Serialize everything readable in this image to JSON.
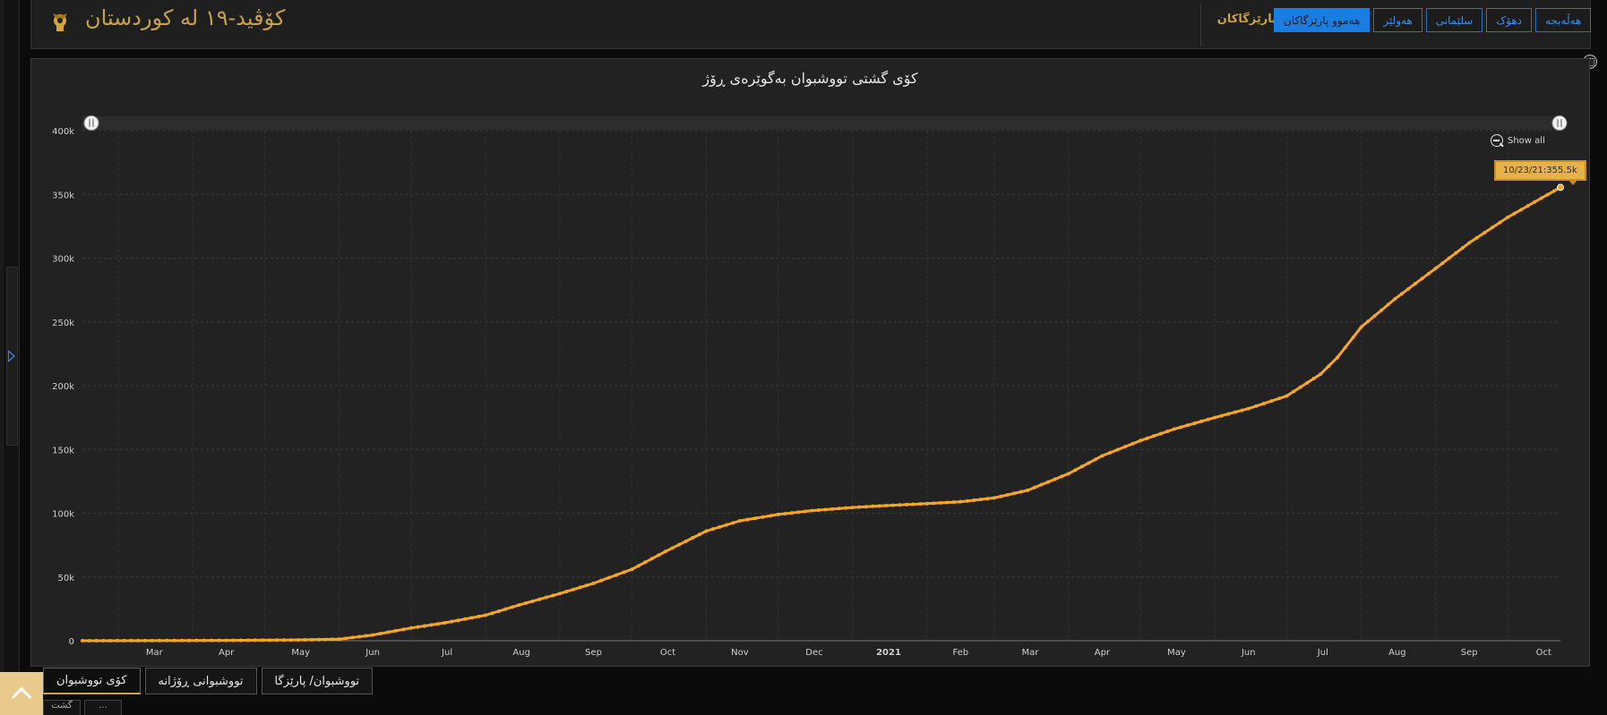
{
  "header": {
    "title": "کۆڤید-١٩ لە کوردستان",
    "provinces_label": "پارێزگاکان",
    "province_buttons": [
      {
        "label": "هەموو پارێزگاکان",
        "active": true
      },
      {
        "label": "هەولێر",
        "active": false
      },
      {
        "label": "سلێمانی",
        "active": false
      },
      {
        "label": "دهۆک",
        "active": false
      },
      {
        "label": "هەڵەبجە",
        "active": false
      }
    ]
  },
  "panel": {
    "show_all_label": "Show all",
    "tooltip_text": "10/23/21:355.5k"
  },
  "tabs": [
    {
      "label": "کۆی تووشبوان",
      "active": true
    },
    {
      "label": "تووشبوانی ڕۆژانە",
      "active": false
    },
    {
      "label": "تووشبوان/ پارێزگا",
      "active": false
    }
  ],
  "bottom_strip": [
    "گشت",
    "..."
  ],
  "colors": {
    "accent": "#f5a623",
    "title_gold": "#c9a04a",
    "button_blue": "#1a7de0",
    "panel_bg": "#222222"
  },
  "chart_data": {
    "type": "line",
    "title": "کۆی گشتی تووشبوان بەگوێرەی ڕۆژ",
    "xlabel": "",
    "ylabel": "",
    "x_tick_labels": [
      "Mar",
      "Apr",
      "May",
      "Jun",
      "Jul",
      "Aug",
      "Sep",
      "Oct",
      "Nov",
      "Dec",
      "2021",
      "Feb",
      "Mar",
      "Apr",
      "May",
      "Jun",
      "Jul",
      "Aug",
      "Sep",
      "Oct"
    ],
    "y_tick_labels": [
      "0",
      "50k",
      "100k",
      "150k",
      "200k",
      "250k",
      "300k",
      "350k",
      "400k"
    ],
    "ylim": [
      0,
      400000
    ],
    "xlim": [
      "2020-02-15",
      "2021-10-23"
    ],
    "grid": true,
    "series": [
      {
        "name": "",
        "points": [
          [
            "2020-02-15",
            0
          ],
          [
            "2020-03-15",
            100
          ],
          [
            "2020-04-15",
            300
          ],
          [
            "2020-05-15",
            600
          ],
          [
            "2020-06-01",
            1200
          ],
          [
            "2020-06-15",
            4500
          ],
          [
            "2020-07-01",
            10000
          ],
          [
            "2020-07-15",
            14000
          ],
          [
            "2020-08-01",
            20000
          ],
          [
            "2020-08-15",
            28000
          ],
          [
            "2020-09-01",
            37000
          ],
          [
            "2020-09-15",
            45000
          ],
          [
            "2020-10-01",
            56000
          ],
          [
            "2020-10-15",
            70000
          ],
          [
            "2020-11-01",
            86000
          ],
          [
            "2020-11-15",
            94000
          ],
          [
            "2020-12-01",
            99000
          ],
          [
            "2020-12-15",
            102000
          ],
          [
            "2021-01-01",
            104500
          ],
          [
            "2021-01-15",
            106000
          ],
          [
            "2021-02-01",
            107500
          ],
          [
            "2021-02-15",
            109000
          ],
          [
            "2021-03-01",
            112000
          ],
          [
            "2021-03-15",
            118000
          ],
          [
            "2021-04-01",
            131000
          ],
          [
            "2021-04-15",
            145000
          ],
          [
            "2021-05-01",
            157000
          ],
          [
            "2021-05-15",
            166000
          ],
          [
            "2021-06-01",
            175000
          ],
          [
            "2021-06-15",
            182000
          ],
          [
            "2021-07-01",
            192000
          ],
          [
            "2021-07-15",
            209000
          ],
          [
            "2021-07-22",
            222000
          ],
          [
            "2021-08-01",
            246000
          ],
          [
            "2021-08-15",
            268000
          ],
          [
            "2021-09-01",
            292000
          ],
          [
            "2021-09-15",
            312000
          ],
          [
            "2021-10-01",
            332000
          ],
          [
            "2021-10-15",
            347000
          ],
          [
            "2021-10-23",
            355500
          ]
        ]
      }
    ]
  }
}
